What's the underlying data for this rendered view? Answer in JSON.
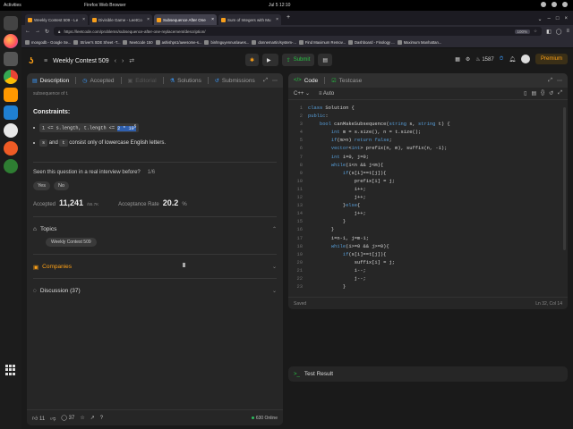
{
  "gnome": {
    "activities": "Activities",
    "app_name": "Firefox Web Browser",
    "clock": "Jul 5  12:10"
  },
  "dock": {
    "apps": [
      "terminal-icon",
      "firefox-icon",
      "files-icon",
      "chrome-icon",
      "sublime-icon",
      "vscode-icon",
      "mongodb-icon",
      "postman-icon",
      "kafka-icon"
    ]
  },
  "browser": {
    "tabs": [
      {
        "label": "Weekly Contest 509 - Le",
        "active": false
      },
      {
        "label": "Divisible Game - LeetCo",
        "active": false
      },
      {
        "label": "Subsequence After One",
        "active": true
      },
      {
        "label": "Sum of Integers with Mu",
        "active": false
      }
    ],
    "url": "https://leetcode.com/problems/subsequence-after-one-replacement/description/",
    "zoom": "100%",
    "bookmarks": [
      "mongodb - Google Se...",
      "Striver's SDE Sheet -T...",
      "Neetcode 150",
      "ashishps1/awesome-s...",
      "binhnguyennus/awes...",
      "donnemartin/system-...",
      "Find Maximum Remov...",
      "Dashboard - Finology ...",
      "Maximum Manhattan..."
    ]
  },
  "lc": {
    "contest_title": "Weekly Contest 509",
    "run_label": "",
    "submit_label": "Submit",
    "streak": "1587",
    "premium_label": "Premium"
  },
  "left_panel": {
    "tabs": [
      "Description",
      "Accepted",
      "Editorial",
      "Solutions",
      "Submissions"
    ],
    "cut_text": "subsequence of t.",
    "constraints_heading": "Constraints:",
    "constraint1_pre": "1 <= s.length, t.length <= ",
    "constraint1_hl": "2 * 10",
    "constraint1_sup": "5",
    "constraint2_a": "s",
    "constraint2_mid": " and ",
    "constraint2_b": "t",
    "constraint2_rest": " consist only of lowercase English letters.",
    "seen_q": "Seen this question in a real interview before?",
    "seen_ratio": "1/6",
    "yes": "Yes",
    "no": "No",
    "accepted_label": "Accepted",
    "accepted_value": "11,241",
    "accepted_total": "/55.7K",
    "rate_label": "Acceptance Rate",
    "rate_value": "20.2",
    "rate_unit": "%",
    "topics_label": "Topics",
    "topic_chip": "Weekly Contest 509",
    "companies_label": "Companies",
    "discussion_label": "Discussion (37)",
    "likes": "11",
    "comments": "37",
    "online": "630 Online"
  },
  "code_panel": {
    "tabs": [
      "Code",
      "Testcase"
    ],
    "language": "C++",
    "mode": "Auto",
    "lines": [
      "class Solution {",
      "public:",
      "    bool canMakeSubsequence(string s, string t) {",
      "        int m = s.size(), n = t.size();",
      "        if(m>n) return false;",
      "        vector<int> prefix(n, m), suffix(n, -1);",
      "        int i=0, j=0;",
      "        while(i<n && j<m){",
      "            if(s[i]==t[j]){",
      "                prefix[i] = j;",
      "                i++;",
      "                j++;",
      "            }else{",
      "                j++;",
      "            }",
      "        }",
      "        i=n-1, j=m-1;",
      "        while(i>=0 && j>=0){",
      "            if(s[i]==t[j]){",
      "                suffix[i] = j;",
      "                i--;",
      "                j--;",
      "            }"
    ],
    "saved": "Saved",
    "position": "Ln 32, Col 14"
  },
  "test_result": {
    "label": "Test Result"
  }
}
